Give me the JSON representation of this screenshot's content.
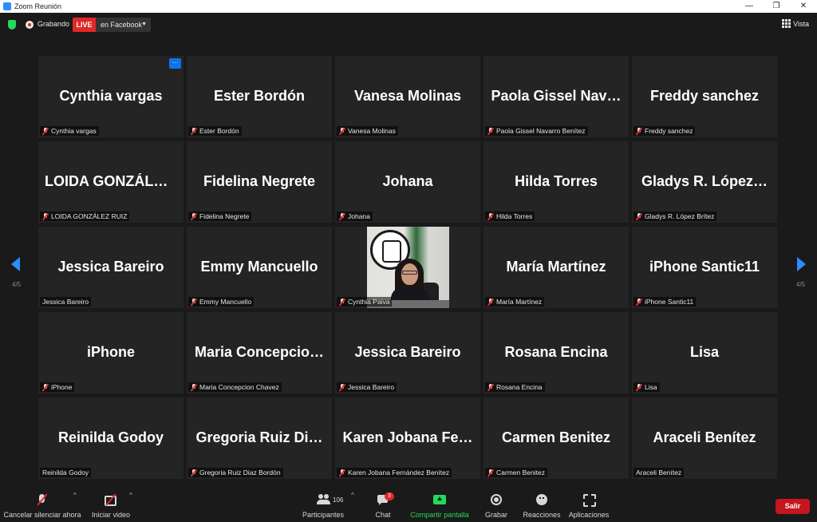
{
  "window": {
    "title": "Zoom Reunión",
    "controls": [
      "—",
      "❐",
      "✕"
    ]
  },
  "topbar": {
    "security_icon": "shield-check-icon",
    "recording_label": "Grabando",
    "live_badge": "LIVE",
    "live_target": "en Facebook",
    "view_label": "Vista"
  },
  "navigation": {
    "page_left": "4/5",
    "page_right": "4/5"
  },
  "tiles": [
    {
      "display": "Cynthia vargas",
      "name": "Cynthia vargas",
      "muted": true
    },
    {
      "display": "Ester Bordón",
      "name": "Ester Bordón",
      "muted": true
    },
    {
      "display": "Vanesa Molinas",
      "name": "Vanesa Molinas",
      "muted": true
    },
    {
      "display": "Paola Gissel Nav…",
      "name": "Paola Gissel Navarro Benítez",
      "muted": true
    },
    {
      "display": "Freddy sanchez",
      "name": "Freddy sanchez",
      "muted": true
    },
    {
      "display": "LOIDA GONZÁLE…",
      "name": "LOIDA GONZÁLEZ RUIZ",
      "muted": true
    },
    {
      "display": "Fidelina Negrete",
      "name": "Fidelina Negrete",
      "muted": true
    },
    {
      "display": "Johana",
      "name": "Johana",
      "muted": true
    },
    {
      "display": "Hilda Torres",
      "name": "Hilda Torres",
      "muted": true
    },
    {
      "display": "Gladys R. López…",
      "name": "Gladys R. López Brítez",
      "muted": true
    },
    {
      "display": "Jessica Bareiro",
      "name": "Jessica Bareiro",
      "muted": false
    },
    {
      "display": "Emmy Mancuello",
      "name": "Emmy Mancuello",
      "muted": true
    },
    {
      "display": "",
      "name": "Cynthia Paiva",
      "muted": true,
      "video": true
    },
    {
      "display": "María Martínez",
      "name": "María Martínez",
      "muted": true
    },
    {
      "display": "iPhone Santic11",
      "name": "iPhone Santic11",
      "muted": true
    },
    {
      "display": "iPhone",
      "name": "iPhone",
      "muted": true
    },
    {
      "display": "Maria Concepcio…",
      "name": "Maria Concepcion Chavez",
      "muted": true
    },
    {
      "display": "Jessica Bareiro",
      "name": "Jessica Bareiro",
      "muted": true
    },
    {
      "display": "Rosana Encina",
      "name": "Rosana Encina",
      "muted": true
    },
    {
      "display": "Lisa",
      "name": "Lisa",
      "muted": true
    },
    {
      "display": "Reinilda Godoy",
      "name": "Reinilda Godoy",
      "muted": false
    },
    {
      "display": "Gregoria Ruiz Di…",
      "name": "Gregoria Ruiz Diaz Bordón",
      "muted": true
    },
    {
      "display": "Karen Jobana Fe…",
      "name": "Karen Jobana Fernández Benítez",
      "muted": true
    },
    {
      "display": "Carmen Benitez",
      "name": "Carmen Benitez",
      "muted": true
    },
    {
      "display": "Araceli Benítez",
      "name": "Araceli Benítez",
      "muted": false
    }
  ],
  "tile_more_label": "···",
  "toolbar": {
    "mute_label": "Cancelar silenciar ahora",
    "video_label": "Iniciar video",
    "participants_label": "Participantes",
    "participants_count": "106",
    "chat_label": "Chat",
    "chat_badge": "3",
    "share_label": "Compartir pantalla",
    "record_label": "Grabar",
    "reactions_label": "Reacciones",
    "apps_label": "Aplicaciones",
    "leave_label": "Salir",
    "caret": "^"
  },
  "colors": {
    "accent": "#2d8cff",
    "live": "#e02828",
    "share": "#23d959",
    "leave": "#c4161c"
  }
}
